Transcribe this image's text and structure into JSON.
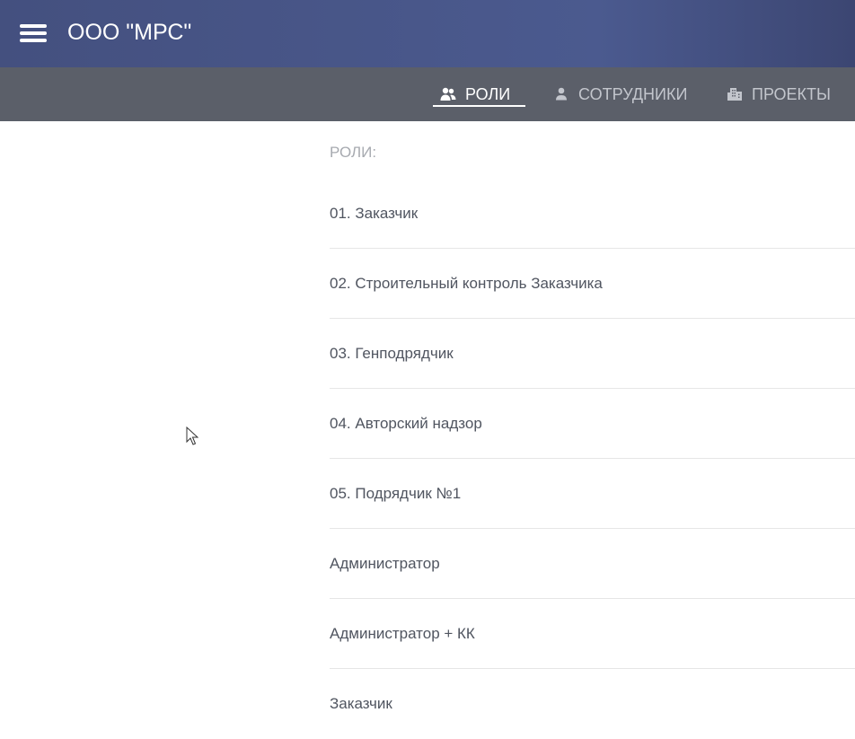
{
  "header": {
    "title": "ООО \"МРС\"",
    "menu_icon": "hamburger-menu-icon",
    "background_color": "#44507f"
  },
  "tabs": [
    {
      "label": "РОЛИ",
      "icon": "people-icon",
      "active": true
    },
    {
      "label": "СОТРУДНИКИ",
      "icon": "person-icon",
      "active": false
    },
    {
      "label": "ПРОЕКТЫ",
      "icon": "buildings-icon",
      "active": false
    }
  ],
  "tab_bar_color": "#5b5f69",
  "roles_section": {
    "title": "РОЛИ:",
    "items": [
      {
        "label": "01. Заказчик"
      },
      {
        "label": "02. Строительный контроль Заказчика"
      },
      {
        "label": "03. Генподрядчик"
      },
      {
        "label": "04. Авторский надзор"
      },
      {
        "label": "05. Подрядчик №1"
      },
      {
        "label": "Администратор"
      },
      {
        "label": "Администратор + КК"
      },
      {
        "label": "Заказчик"
      }
    ]
  }
}
